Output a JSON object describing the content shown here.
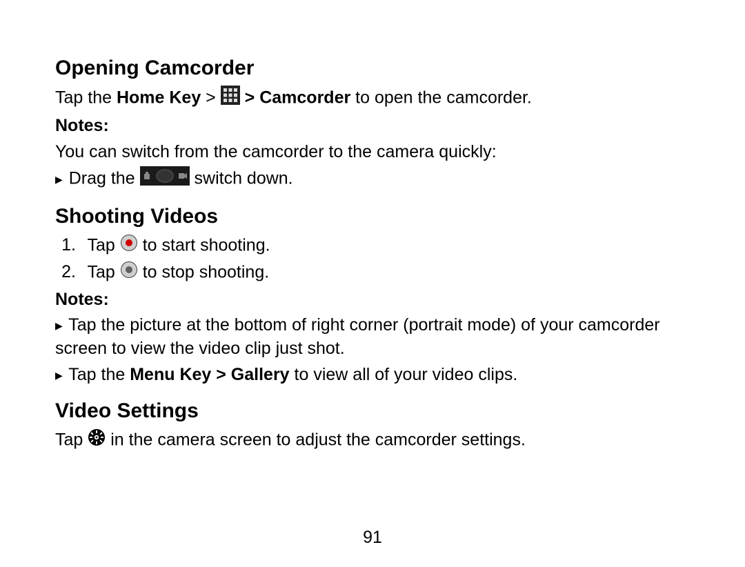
{
  "section1": {
    "heading": "Opening Camcorder",
    "line1_a": "Tap the ",
    "line1_b": "Home Key",
    "line1_c": " > ",
    "line1_d": " > Camcorder",
    "line1_e": " to open the camcorder.",
    "notes_label": "Notes:",
    "notes_intro": "You can switch from the camcorder to the camera quickly:",
    "bullet_a": " Drag the ",
    "bullet_b": " switch down."
  },
  "section2": {
    "heading": "Shooting Videos",
    "step1_num": "1.",
    "step1_a": "Tap ",
    "step1_b": " to start shooting.",
    "step2_num": "2.",
    "step2_a": "Tap ",
    "step2_b": " to stop shooting.",
    "notes_label": "Notes:",
    "bullet1": " Tap the picture at the bottom of right corner (portrait mode) of your camcorder screen to view the video clip just shot.",
    "bullet2_a": " Tap the ",
    "bullet2_b": "Menu Key > Gallery",
    "bullet2_c": " to view all of your video clips."
  },
  "section3": {
    "heading": "Video Settings",
    "line1_a": "Tap ",
    "line1_b": " in the camera screen to adjust the camcorder settings."
  },
  "page_number": "91"
}
